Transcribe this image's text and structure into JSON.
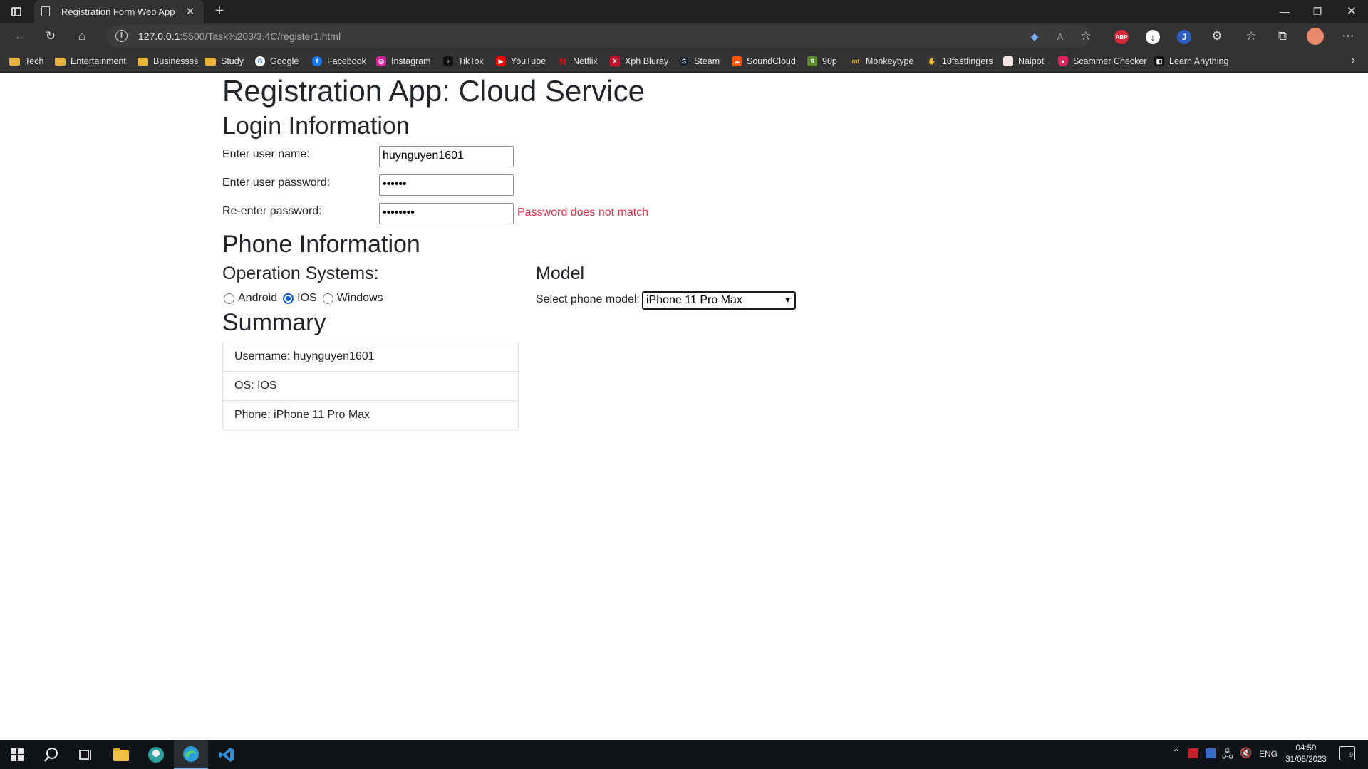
{
  "browser": {
    "tab_title": "Registration Form Web App",
    "url_host": "127.0.0.1",
    "url_rest": ":5500/Task%203/3.4C/register1.html",
    "bookmarks": [
      {
        "label": "Tech",
        "icon": "folder-icon"
      },
      {
        "label": "Entertainment",
        "icon": "folder-icon"
      },
      {
        "label": "Businessss",
        "icon": "folder-icon"
      },
      {
        "label": "Study",
        "icon": "folder-icon"
      },
      {
        "label": "Google",
        "icon": "google-icon"
      },
      {
        "label": "Facebook",
        "icon": "facebook-icon"
      },
      {
        "label": "Instagram",
        "icon": "instagram-icon"
      },
      {
        "label": "TikTok",
        "icon": "tiktok-icon"
      },
      {
        "label": "YouTube",
        "icon": "youtube-icon"
      },
      {
        "label": "Netflix",
        "icon": "netflix-icon"
      },
      {
        "label": "Xph Bluray",
        "icon": "xph-icon"
      },
      {
        "label": "Steam",
        "icon": "steam-icon"
      },
      {
        "label": "SoundCloud",
        "icon": "soundcloud-icon"
      },
      {
        "label": "90p",
        "icon": "90p-icon"
      },
      {
        "label": "Monkeytype",
        "icon": "monkeytype-icon"
      },
      {
        "label": "10fastfingers",
        "icon": "10fastfingers-icon"
      },
      {
        "label": "Naipot",
        "icon": "naipot-icon"
      },
      {
        "label": "Scammer Checker",
        "icon": "scammer-checker-icon"
      },
      {
        "label": "Learn Anything",
        "icon": "learn-anything-icon"
      }
    ],
    "ext_abp": "ABP"
  },
  "page": {
    "title": "Registration App: Cloud Service",
    "login_heading": "Login Information",
    "username_label": "Enter user name:",
    "username_value": "huynguyen1601",
    "password_label": "Enter user password:",
    "password_value": "••••••",
    "repassword_label": "Re-enter password:",
    "repassword_value": "••••••••",
    "password_error": "Password does not match",
    "phone_heading": "Phone Information",
    "os_heading": "Operation Systems:",
    "os_options": [
      "Android",
      "IOS",
      "Windows"
    ],
    "os_selected": "IOS",
    "model_heading": "Model",
    "model_label": "Select phone model:",
    "model_value": "iPhone 11 Pro Max",
    "summary_heading": "Summary",
    "summary_items": [
      "Username: huynguyen1601",
      "OS: IOS",
      "Phone: iPhone 11 Pro Max"
    ]
  },
  "colors": {
    "error": "#dc3545",
    "radio_accent": "#0b57d0",
    "chrome_dark": "#202020",
    "chrome_toolbar": "#333333"
  },
  "taskbar": {
    "lang": "ENG",
    "time": "04:59",
    "date": "31/05/2023",
    "notification_count": "9"
  }
}
